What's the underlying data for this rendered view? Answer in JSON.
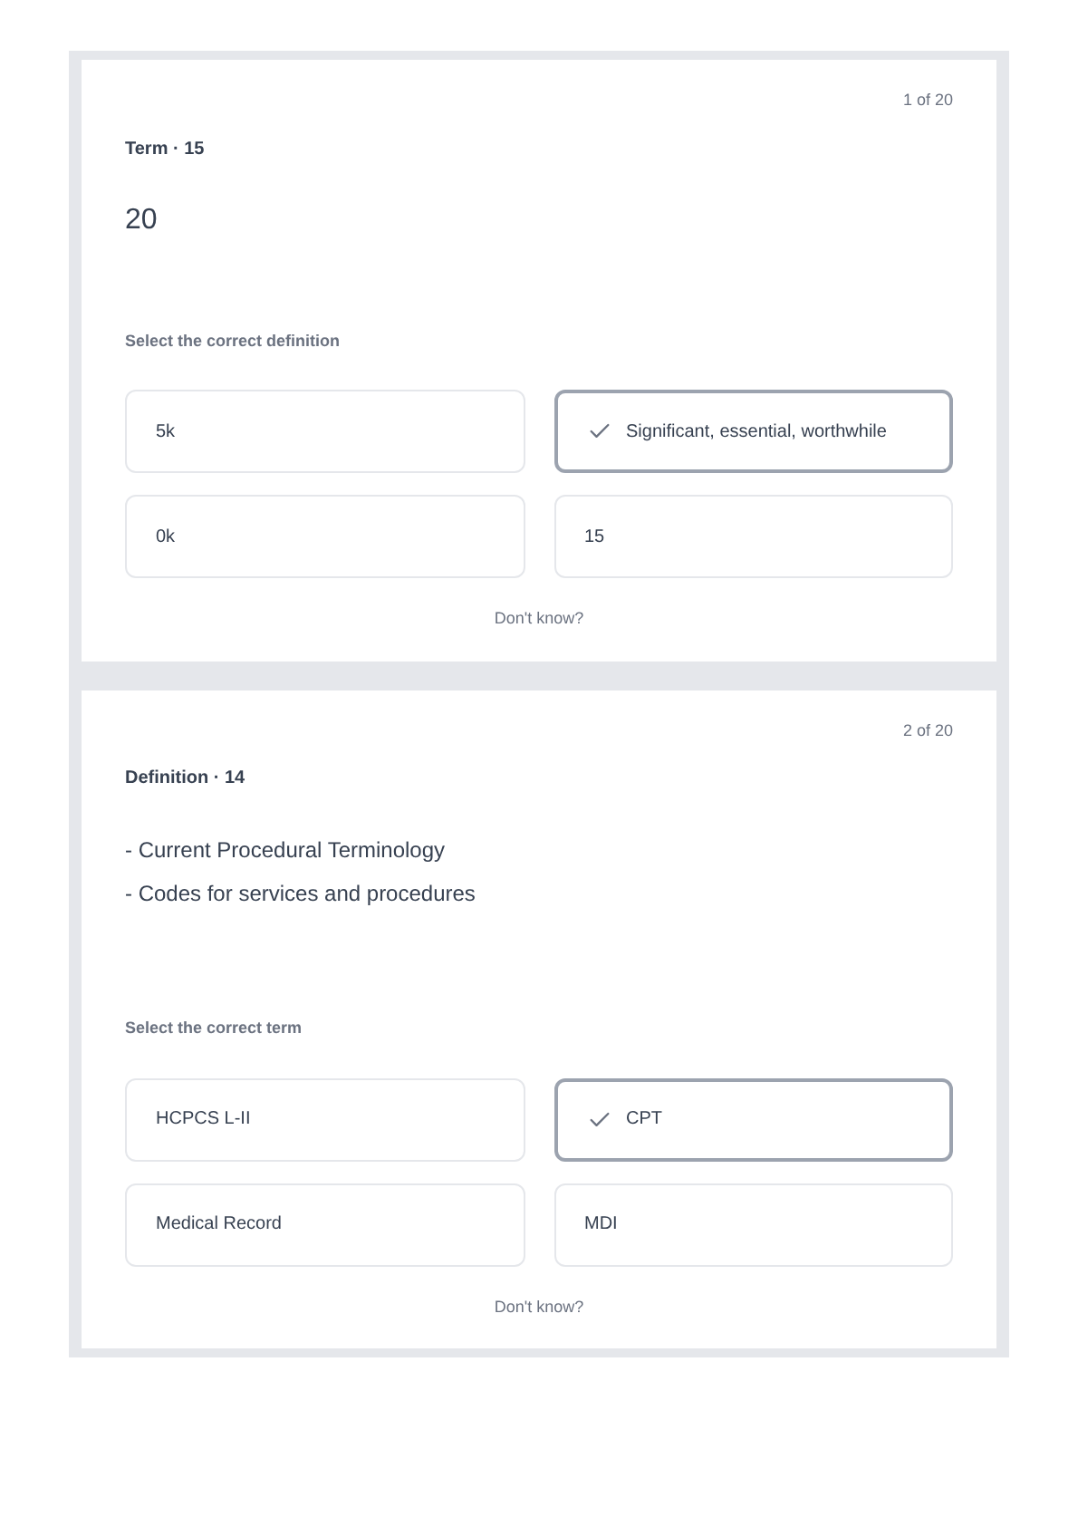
{
  "cards": [
    {
      "counter": "1 of 20",
      "label": "Term · 15",
      "prompt_lines": [
        "20"
      ],
      "instruction": "Select the correct definition",
      "options": [
        {
          "text": "5k",
          "selected": false
        },
        {
          "text": "Significant, essential, worthwhile",
          "selected": true
        },
        {
          "text": "0k",
          "selected": false
        },
        {
          "text": "15",
          "selected": false
        }
      ],
      "skip": "Don't know?"
    },
    {
      "counter": "2 of 20",
      "label": "Definition · 14",
      "prompt_lines": [
        "- Current Procedural Terminology",
        "- Codes for services and procedures"
      ],
      "instruction": "Select the correct term",
      "options": [
        {
          "text": "HCPCS L-II",
          "selected": false
        },
        {
          "text": "CPT",
          "selected": true
        },
        {
          "text": "Medical Record",
          "selected": false
        },
        {
          "text": "MDI",
          "selected": false
        }
      ],
      "skip": "Don't know?"
    }
  ]
}
